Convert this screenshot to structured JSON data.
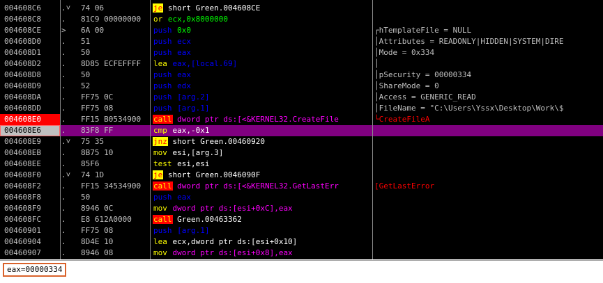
{
  "disassembly": {
    "rows": [
      {
        "address": "004608C6",
        "mark": ".˅",
        "hex": "74 06",
        "mnemonic": "je",
        "mtype": "jcc",
        "operands": " short Green.004608CE",
        "otype": "plain",
        "comment": ""
      },
      {
        "address": "004608C8",
        "mark": ".",
        "hex": "81C9 00000000",
        "mnemonic": "or",
        "mtype": "or",
        "operands": " ecx,0x8000000",
        "otype": "hex",
        "comment": ""
      },
      {
        "address": "004608CE",
        "mark": ">",
        "hex": "6A 00",
        "mnemonic": "push",
        "mtype": "push",
        "operands": " 0x0",
        "otype": "hex",
        "comment": "┌hTemplateFile = NULL",
        "ctype": "plain"
      },
      {
        "address": "004608D0",
        "mark": ".",
        "hex": "51",
        "mnemonic": "push",
        "mtype": "push",
        "operands": " ecx",
        "otype": "push",
        "comment": "│Attributes = READONLY|HIDDEN|SYSTEM|DIRE",
        "ctype": "plain"
      },
      {
        "address": "004608D1",
        "mark": ".",
        "hex": "50",
        "mnemonic": "push",
        "mtype": "push",
        "operands": " eax",
        "otype": "push",
        "comment": "│Mode = 0x334",
        "ctype": "plain"
      },
      {
        "address": "004608D2",
        "mark": ".",
        "hex": "8D85 ECFEFFFF",
        "mnemonic": "lea",
        "mtype": "lea",
        "operands": " eax,[local.69]",
        "otype": "push",
        "comment": "│",
        "ctype": "plain"
      },
      {
        "address": "004608D8",
        "mark": ".",
        "hex": "50",
        "mnemonic": "push",
        "mtype": "push",
        "operands": " eax",
        "otype": "push",
        "comment": "│pSecurity = 00000334",
        "ctype": "plain"
      },
      {
        "address": "004608D9",
        "mark": ".",
        "hex": "52",
        "mnemonic": "push",
        "mtype": "push",
        "operands": " edx",
        "otype": "push",
        "comment": "│ShareMode = 0",
        "ctype": "plain"
      },
      {
        "address": "004608DA",
        "mark": ".",
        "hex": "FF75 0C",
        "mnemonic": "push",
        "mtype": "push",
        "operands": " [arg.2]",
        "otype": "push",
        "comment": "│Access = GENERIC_READ",
        "ctype": "plain"
      },
      {
        "address": "004608DD",
        "mark": ".",
        "hex": "FF75 08",
        "mnemonic": "push",
        "mtype": "push",
        "operands": " [arg.1]",
        "otype": "push",
        "comment": "│FileName = \"C:\\Users\\Yssx\\Desktop\\Work\\$",
        "ctype": "plain"
      },
      {
        "address": "004608E0",
        "mark": ".",
        "hex": "FF15 B0534900",
        "mnemonic": "call",
        "mtype": "call",
        "operands": " dword ptr ds:[<&KERNEL32.CreateFile",
        "otype": "call",
        "comment": "└CreateFileA",
        "ctype": "api",
        "bp": true
      },
      {
        "address": "004608E6",
        "mark": ".",
        "hex": "83F8 FF",
        "mnemonic": "cmp",
        "mtype": "cmp",
        "operands": " eax,-0x1",
        "otype": "cmp",
        "comment": "",
        "current": true
      },
      {
        "address": "004608E9",
        "mark": ".˅",
        "hex": "75 35",
        "mnemonic": "jnz",
        "mtype": "jcc",
        "operands": " short Green.00460920",
        "otype": "plain",
        "comment": ""
      },
      {
        "address": "004608EB",
        "mark": ".",
        "hex": "8B75 10",
        "mnemonic": "mov",
        "mtype": "mov",
        "operands": " esi,[arg.3]",
        "otype": "plain",
        "comment": ""
      },
      {
        "address": "004608EE",
        "mark": ".",
        "hex": "85F6",
        "mnemonic": "test",
        "mtype": "test",
        "operands": " esi,esi",
        "otype": "plain",
        "comment": ""
      },
      {
        "address": "004608F0",
        "mark": ".˅",
        "hex": "74 1D",
        "mnemonic": "je",
        "mtype": "jcc",
        "operands": " short Green.0046090F",
        "otype": "plain",
        "comment": ""
      },
      {
        "address": "004608F2",
        "mark": ".",
        "hex": "FF15 34534900",
        "mnemonic": "call",
        "mtype": "call",
        "operands": " dword ptr ds:[<&KERNEL32.GetLastErr",
        "otype": "call",
        "comment": "[GetLastError",
        "ctype": "api"
      },
      {
        "address": "004608F8",
        "mark": ".",
        "hex": "50",
        "mnemonic": "push",
        "mtype": "push",
        "operands": " eax",
        "otype": "push",
        "comment": ""
      },
      {
        "address": "004608F9",
        "mark": ".",
        "hex": "8946 0C",
        "mnemonic": "mov",
        "mtype": "mov",
        "operands": " dword ptr ds:[esi+0xC],eax",
        "otype": "call",
        "comment": ""
      },
      {
        "address": "004608FC",
        "mark": ".",
        "hex": "E8 612A0000",
        "mnemonic": "call",
        "mtype": "call",
        "operands": " Green.00463362",
        "otype": "plain",
        "comment": ""
      },
      {
        "address": "00460901",
        "mark": ".",
        "hex": "FF75 08",
        "mnemonic": "push",
        "mtype": "push",
        "operands": " [arg.1]",
        "otype": "push",
        "comment": ""
      },
      {
        "address": "00460904",
        "mark": ".",
        "hex": "8D4E 10",
        "mnemonic": "lea",
        "mtype": "lea",
        "operands": " ecx,dword ptr ds:[esi+0x10]",
        "otype": "plain",
        "comment": ""
      },
      {
        "address": "00460907",
        "mark": ".",
        "hex": "8946 08",
        "mnemonic": "mov",
        "mtype": "mov",
        "operands": " dword ptr ds:[esi+0x8],eax",
        "otype": "call",
        "comment": ""
      }
    ]
  },
  "info_pane": {
    "text": "eax=00000334"
  }
}
